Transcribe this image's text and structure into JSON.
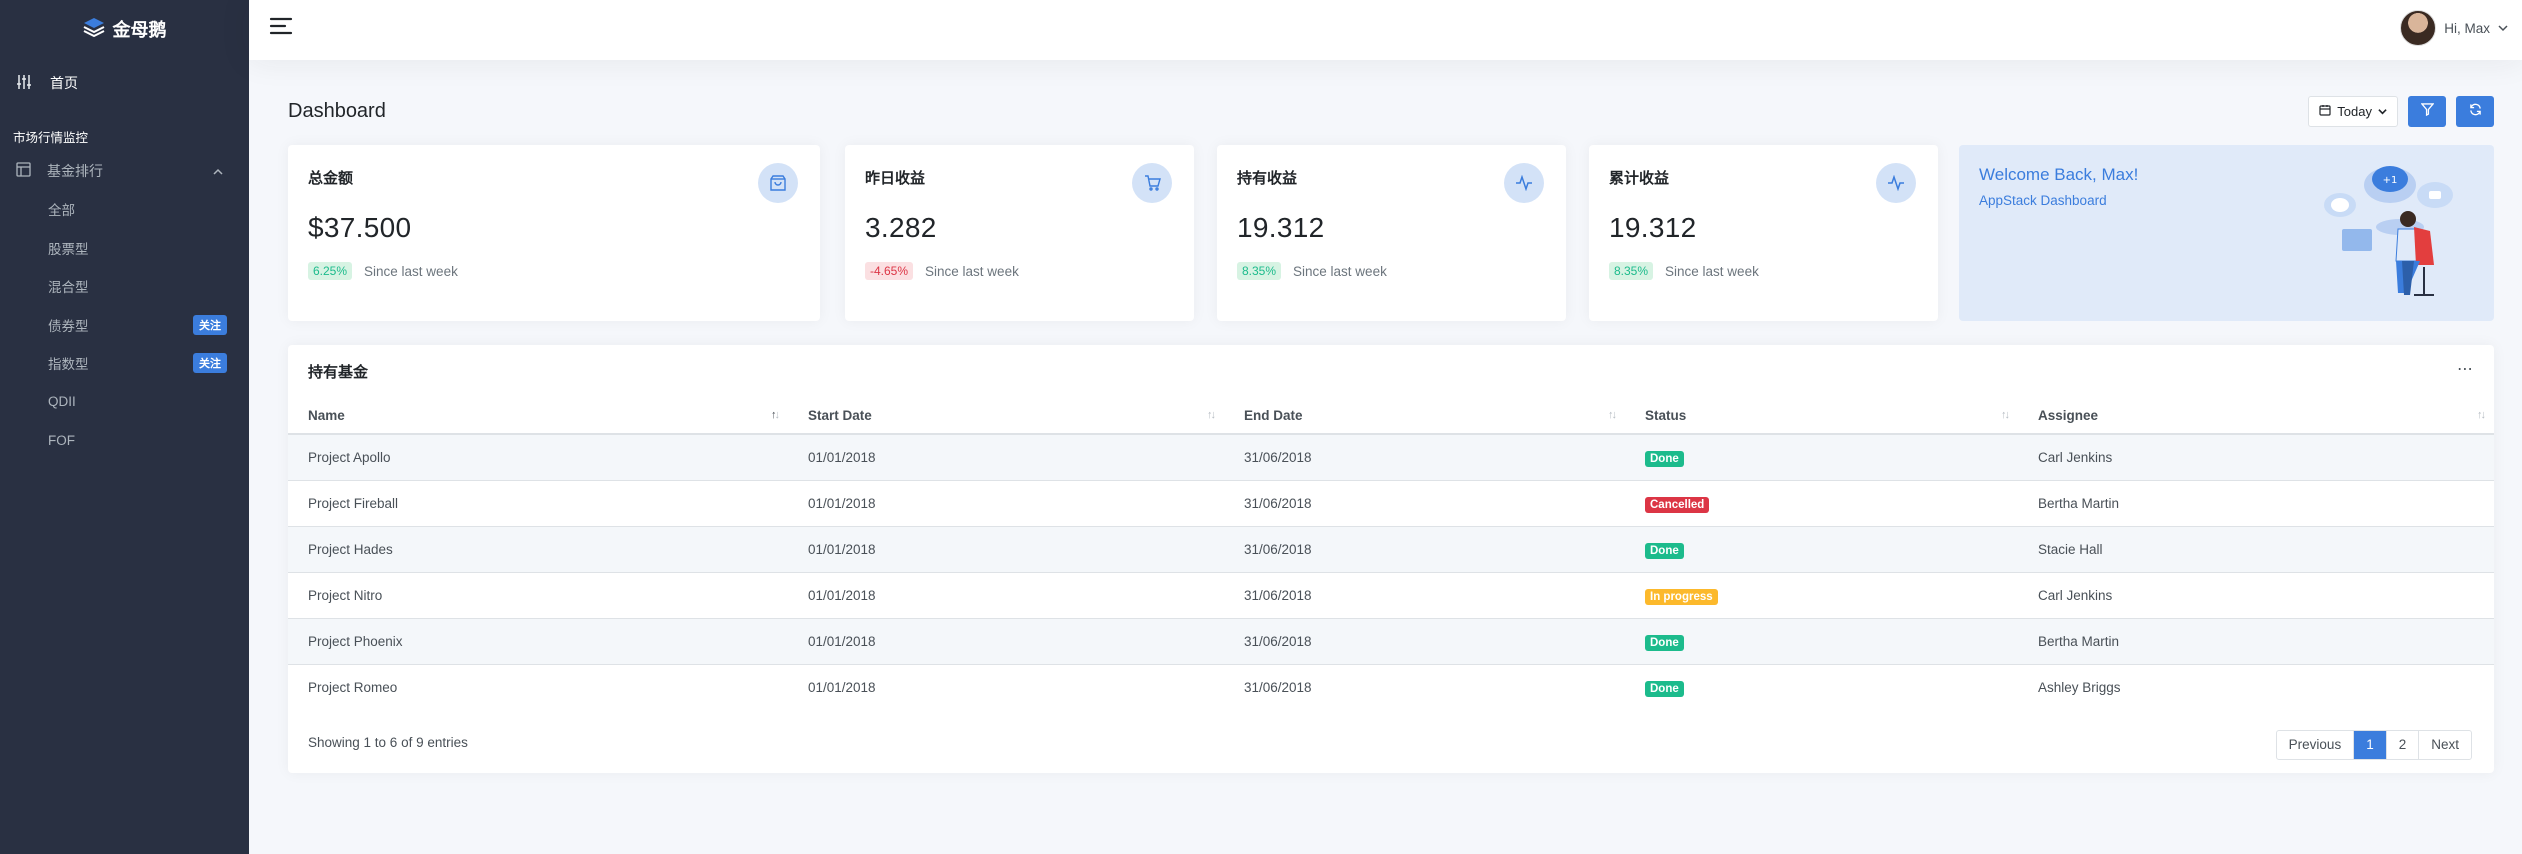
{
  "brand": {
    "name": "金母鹅"
  },
  "sidebar": {
    "home": "首页",
    "section_header": "市场行情监控",
    "group": "基金排行",
    "items": [
      {
        "label": "全部",
        "badge": ""
      },
      {
        "label": "股票型",
        "badge": ""
      },
      {
        "label": "混合型",
        "badge": ""
      },
      {
        "label": "债券型",
        "badge": "关注"
      },
      {
        "label": "指数型",
        "badge": "关注"
      },
      {
        "label": "QDII",
        "badge": ""
      },
      {
        "label": "FOF",
        "badge": ""
      }
    ]
  },
  "topbar": {
    "greeting": "Hi, Max"
  },
  "header": {
    "title": "Dashboard",
    "range": "Today"
  },
  "stats": [
    {
      "title": "总金额",
      "value": "$37.500",
      "change": "6.25%",
      "trend": "up",
      "caption": "Since last week",
      "icon": "shopping-bag-icon"
    },
    {
      "title": "昨日收益",
      "value": "3.282",
      "change": "-4.65%",
      "trend": "down",
      "caption": "Since last week",
      "icon": "shopping-cart-icon"
    },
    {
      "title": "持有收益",
      "value": "19.312",
      "change": "8.35%",
      "trend": "up",
      "caption": "Since last week",
      "icon": "activity-icon"
    },
    {
      "title": "累计收益",
      "value": "19.312",
      "change": "8.35%",
      "trend": "up",
      "caption": "Since last week",
      "icon": "activity-icon"
    }
  ],
  "welcome": {
    "title": "Welcome Back, Max!",
    "subtitle": "AppStack Dashboard"
  },
  "table": {
    "title": "持有基金",
    "columns": [
      "Name",
      "Start Date",
      "End Date",
      "Status",
      "Assignee"
    ],
    "rows": [
      {
        "name": "Project Apollo",
        "start": "01/01/2018",
        "end": "31/06/2018",
        "status": "Done",
        "assignee": "Carl Jenkins"
      },
      {
        "name": "Project Fireball",
        "start": "01/01/2018",
        "end": "31/06/2018",
        "status": "Cancelled",
        "assignee": "Bertha Martin"
      },
      {
        "name": "Project Hades",
        "start": "01/01/2018",
        "end": "31/06/2018",
        "status": "Done",
        "assignee": "Stacie Hall"
      },
      {
        "name": "Project Nitro",
        "start": "01/01/2018",
        "end": "31/06/2018",
        "status": "In progress",
        "assignee": "Carl Jenkins"
      },
      {
        "name": "Project Phoenix",
        "start": "01/01/2018",
        "end": "31/06/2018",
        "status": "Done",
        "assignee": "Bertha Martin"
      },
      {
        "name": "Project Romeo",
        "start": "01/01/2018",
        "end": "31/06/2018",
        "status": "Done",
        "assignee": "Ashley Briggs"
      }
    ],
    "showing": "Showing 1 to 6 of 9 entries",
    "pager": {
      "previous": "Previous",
      "pages": [
        "1",
        "2"
      ],
      "next": "Next",
      "current": "1"
    }
  },
  "colors": {
    "sidebar": "#293042",
    "accent": "#3b7ddd",
    "success": "#1cbb8c",
    "danger": "#dc3545",
    "warning": "#fcb92c"
  }
}
